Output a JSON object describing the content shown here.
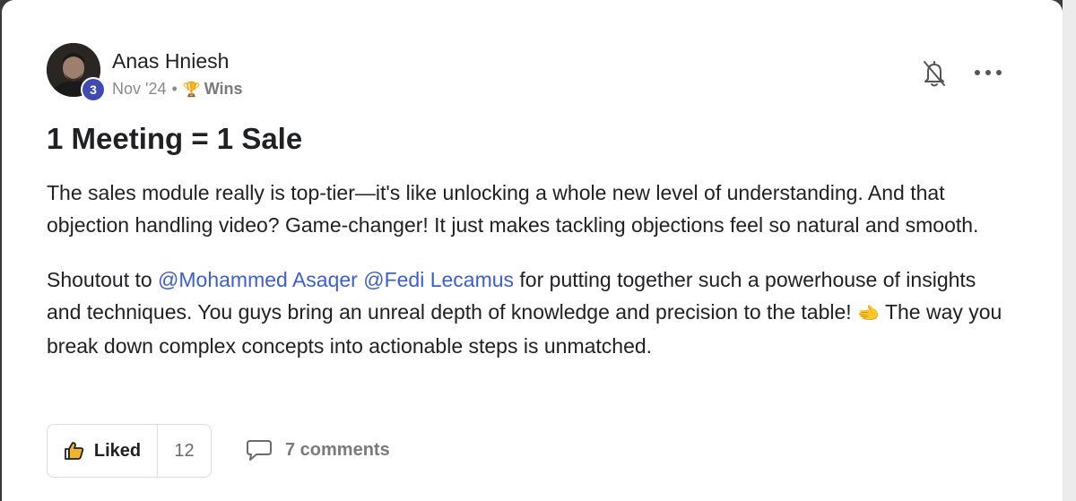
{
  "post": {
    "author": {
      "name": "Anas Hniesh",
      "level": "3"
    },
    "meta": {
      "date": "Nov '24",
      "separator": "•",
      "category_icon": "🏆",
      "category": "Wins"
    },
    "title": "1 Meeting = 1 Sale",
    "body": {
      "paragraph1": "The sales module really is top-tier—it's like unlocking a whole new level of understanding. And that objection handling video? Game-changer! It just makes tackling objections feel so natural and smooth.",
      "p2_intro": "Shoutout to ",
      "mention1": "@Mohammed Asaqer",
      "mention_space": " ",
      "mention2": "@Fedi Lecamus",
      "p2_rest": " for putting together such a powerhouse of insights and techniques. You guys bring an unreal depth of knowledge and precision to the table! ",
      "p2_emoji": "🫲",
      "p2_end": " The way you break down complex concepts into actionable steps is unmatched."
    },
    "actions": {
      "like_label": "Liked",
      "like_count": "12",
      "comments_label": "7 comments"
    },
    "icons": {
      "bell": "bell-off-icon",
      "more": "more-horizontal-icon",
      "like": "thumbs-up-icon",
      "comment": "comment-icon"
    }
  }
}
